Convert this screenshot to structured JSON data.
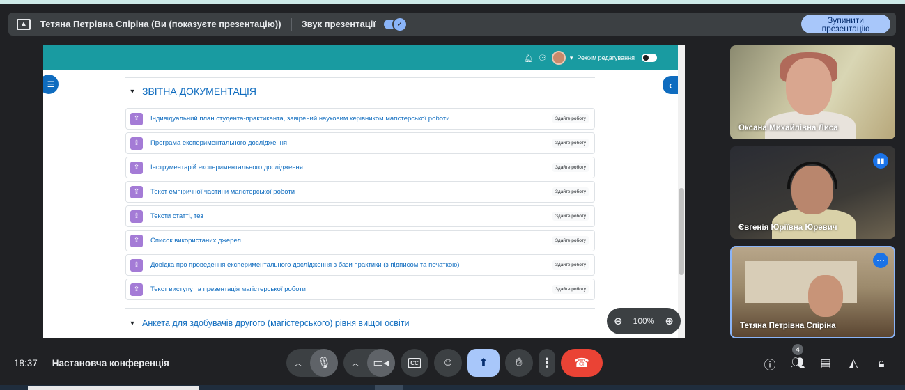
{
  "share_bar": {
    "presenter": "Тетяна Петрівна Спіріна (Ви (показуєте презентацію))",
    "sound_label": "Звук презентації",
    "sound_on": true,
    "stop_line1": "Зупинити",
    "stop_line2": "презентацію"
  },
  "lms": {
    "header_edit_mode": "Режим редагування",
    "section1_title": "ЗВІТНА ДОКУМЕНТАЦІЯ",
    "activities": [
      {
        "name": "Індивідуальний план студента-практиканта, завірений науковим керівником магістерської роботи",
        "badge": "Здайте роботу"
      },
      {
        "name": "Програма експериментального дослідження",
        "badge": "Здайте роботу"
      },
      {
        "name": "Інструментарій експериментального дослідження",
        "badge": "Здайте роботу"
      },
      {
        "name": "Текст емпіричної частини магістерської роботи",
        "badge": "Здайте роботу"
      },
      {
        "name": "Тексти статті, тез",
        "badge": "Здайте роботу"
      },
      {
        "name": "Список використаних джерел",
        "badge": "Здайте роботу"
      },
      {
        "name": "Довідка про проведення експериментального дослідження з бази практики (з підписом та печаткою)",
        "badge": "Здайте роботу"
      },
      {
        "name": "Текст виступу та презентація магістерської роботи",
        "badge": "Здайте роботу"
      }
    ],
    "section2_title": "Анкета для здобувачів другого (магістерського) рівня вищої освіти"
  },
  "zoom": {
    "level": "100%"
  },
  "participants": [
    {
      "name": "Оксана Михайлівна Лиса"
    },
    {
      "name": "Євгенія Юріївна Юревич"
    },
    {
      "name": "Тетяна Петрівна Спіріна"
    }
  ],
  "bottom": {
    "time": "18:37",
    "meeting_name": "Настановча конференція",
    "people_count": "4"
  },
  "colors": {
    "lms_header": "#199ba1",
    "link": "#0f6cbf",
    "accent": "#a8c7fa",
    "hangup": "#ea4335"
  },
  "icons": [
    "present-icon",
    "bell-icon",
    "chat-icon",
    "info-icon",
    "people-icon",
    "chat-panel-icon",
    "activities-icon",
    "host-controls-icon",
    "mic-icon",
    "camera-icon",
    "captions-icon",
    "emoji-icon",
    "present-now-icon",
    "raise-hand-icon",
    "more-options-icon",
    "hangup-icon",
    "zoom-out-icon",
    "zoom-in-icon"
  ]
}
